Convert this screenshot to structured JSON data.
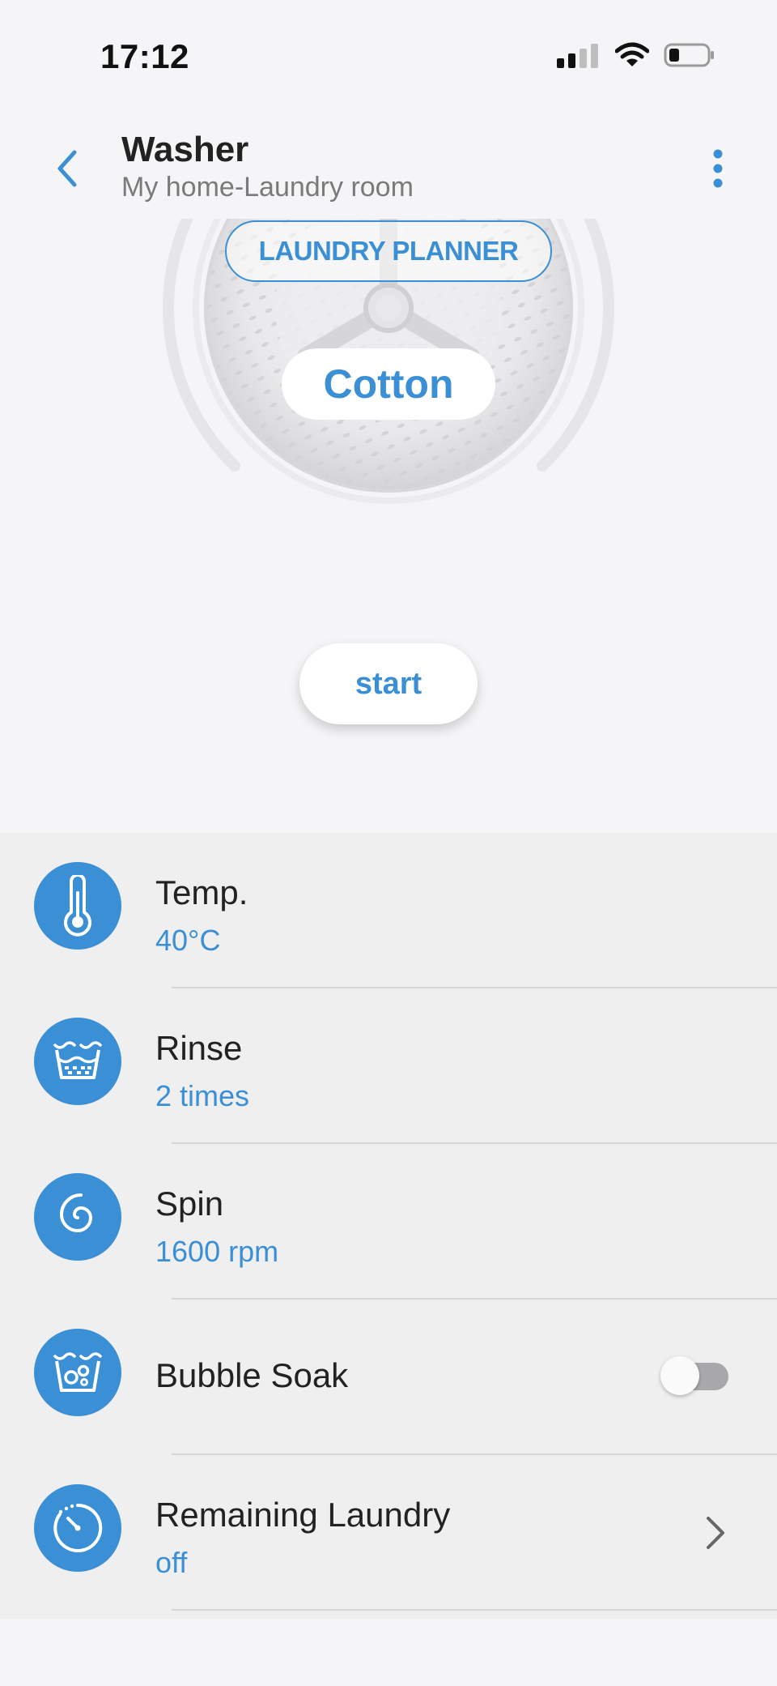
{
  "status_bar": {
    "time": "17:12",
    "icons": [
      "signal-icon",
      "wifi-icon",
      "battery-icon"
    ]
  },
  "header": {
    "title": "Washer",
    "subtitle": "My home-Laundry room",
    "back_icon": "chevron-left-icon",
    "more_icon": "more-vertical-icon"
  },
  "drum": {
    "planner_label": "LAUNDRY PLANNER",
    "program": "Cotton",
    "start_label": "start"
  },
  "settings": [
    {
      "label": "Temp.",
      "value": "40°C",
      "icon": "thermometer-icon"
    },
    {
      "label": "Rinse",
      "value": "2 times",
      "icon": "rinse-basin-icon"
    },
    {
      "label": "Spin",
      "value": "1600 rpm",
      "icon": "spin-spiral-icon"
    },
    {
      "label": "Bubble Soak",
      "icon": "bubble-soak-icon",
      "toggle_on": false
    },
    {
      "label": "Remaining Laundry",
      "value": "off",
      "icon": "timer-icon",
      "accessory": "chevron-right-icon"
    }
  ],
  "colors": {
    "accent": "#3b8fd4",
    "background": "#f5f5f7",
    "list_background": "#efeff0",
    "toggle_off": "#a8a8aa"
  }
}
